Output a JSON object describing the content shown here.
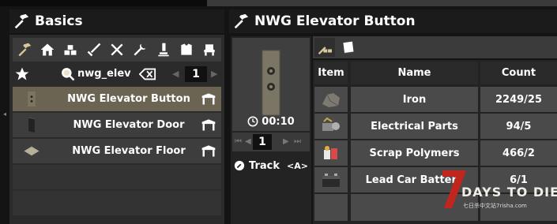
{
  "left_panel": {
    "title": "Basics",
    "categories": [
      "hammer-icon",
      "house-icon",
      "blocks-icon",
      "sword-icon",
      "tools-icon",
      "wrench-icon",
      "science-icon",
      "armor-icon",
      "chair-icon"
    ],
    "search": {
      "value": "nwg_elev",
      "page": "1"
    },
    "recipes": [
      {
        "label": "NWG Elevator Button",
        "selected": true
      },
      {
        "label": "NWG Elevator Door",
        "selected": false
      },
      {
        "label": "NWG Elevator Floor",
        "selected": false
      }
    ]
  },
  "right_panel": {
    "title": "NWG Elevator Button",
    "craft_time": "00:10",
    "quantity": "1",
    "track_label": "Track",
    "track_key": "<A>",
    "table": {
      "headers": {
        "item": "Item",
        "name": "Name",
        "count": "Count"
      },
      "rows": [
        {
          "name": "Iron",
          "count": "2249/25"
        },
        {
          "name": "Electrical Parts",
          "count": "94/5"
        },
        {
          "name": "Scrap Polymers",
          "count": "466/2"
        },
        {
          "name": "Lead Car Battery",
          "count": "6/1"
        }
      ]
    }
  },
  "watermark": {
    "logo_text": "7 DAYS TO DIE",
    "sub_text": "七日杀中文站7risha.com"
  },
  "colors": {
    "selected_row": "#6b6452",
    "panel": "#3b3b3b",
    "accent_red": "#c0261d"
  }
}
